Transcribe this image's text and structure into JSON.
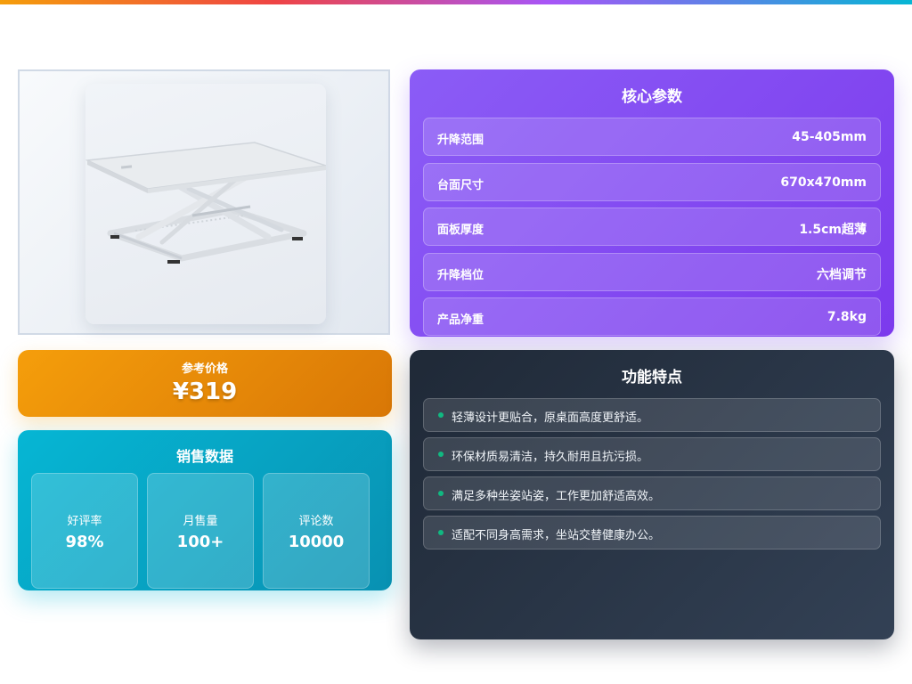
{
  "product": {
    "image_alt": "foldable standing desk converter"
  },
  "price": {
    "label": "参考价格",
    "value": "¥319"
  },
  "sales": {
    "title": "销售数据",
    "stats": [
      {
        "label": "好评率",
        "value": "98%"
      },
      {
        "label": "月售量",
        "value": "100+"
      },
      {
        "label": "评论数",
        "value": "10000"
      }
    ]
  },
  "params": {
    "title": "核心参数",
    "items": [
      {
        "label": "升降范围",
        "value": "45-405mm"
      },
      {
        "label": "台面尺寸",
        "value": "670x470mm"
      },
      {
        "label": "面板厚度",
        "value": "1.5cm超薄"
      },
      {
        "label": "升降档位",
        "value": "六档调节"
      },
      {
        "label": "产品净重",
        "value": "7.8kg"
      }
    ]
  },
  "features": {
    "title": "功能特点",
    "items": [
      "轻薄设计更贴合，原桌面高度更舒适。",
      "环保材质易清洁，持久耐用且抗污损。",
      "满足多种坐姿站姿，工作更加舒适高效。",
      "适配不同身高需求，坐站交替健康办公。"
    ]
  },
  "colors": {
    "price_accent": "#f59e0b",
    "sales_accent": "#06b6d4",
    "params_accent": "#8b5cf6",
    "features_bg": "#1f2937",
    "feature_bullet": "#10b981"
  }
}
